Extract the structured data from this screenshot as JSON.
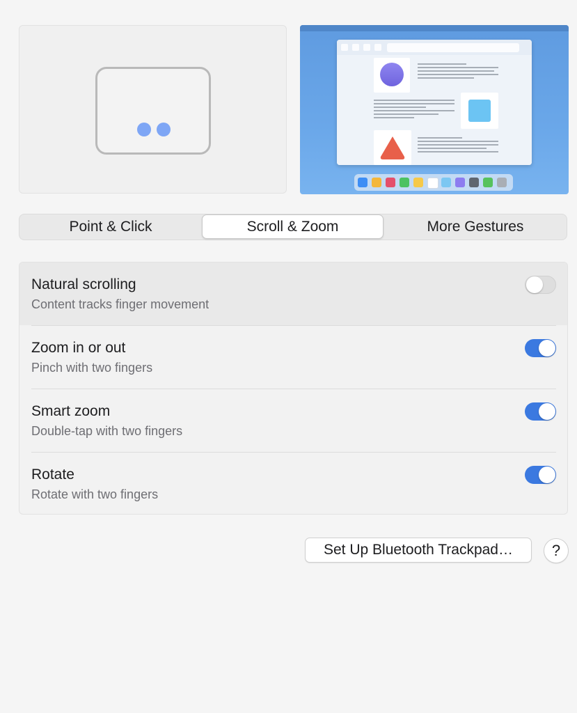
{
  "preview": {
    "dock_colors": [
      "#3d8ef5",
      "#f4b73a",
      "#e4506c",
      "#4cc261",
      "#f6c94a",
      "#ffffff",
      "#7cc7f2",
      "#8d7df0",
      "#5f6670",
      "#57c25d",
      "#a9aeb5"
    ]
  },
  "tabs": {
    "point_click": "Point & Click",
    "scroll_zoom": "Scroll & Zoom",
    "more_gestures": "More Gestures",
    "selected": "Scroll & Zoom"
  },
  "settings": [
    {
      "title": "Natural scrolling",
      "subtitle": "Content tracks finger movement",
      "enabled": false
    },
    {
      "title": "Zoom in or out",
      "subtitle": "Pinch with two fingers",
      "enabled": true
    },
    {
      "title": "Smart zoom",
      "subtitle": "Double-tap with two fingers",
      "enabled": true
    },
    {
      "title": "Rotate",
      "subtitle": "Rotate with two fingers",
      "enabled": true
    }
  ],
  "footer": {
    "bluetooth_button": "Set Up Bluetooth Trackpad…",
    "help_button": "?"
  },
  "colors": {
    "accent": "#3b79e0",
    "finger_dot": "#7ea6f5"
  }
}
